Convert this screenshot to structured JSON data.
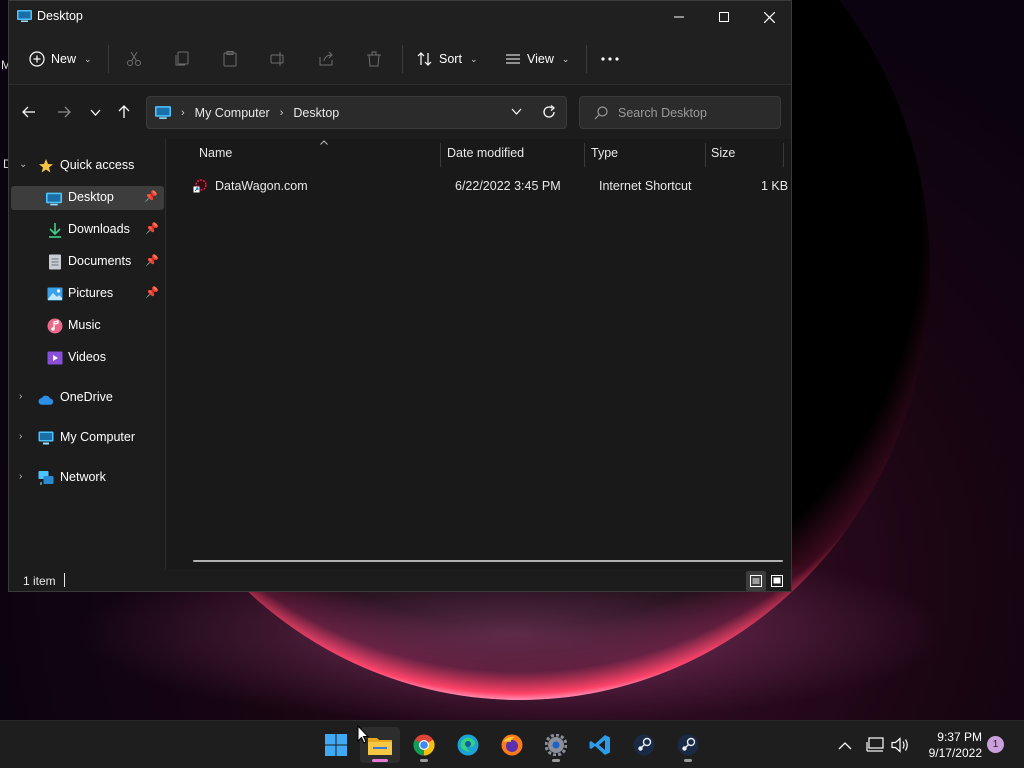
{
  "window": {
    "title": "Desktop"
  },
  "toolbar": {
    "new_label": "New",
    "sort_label": "Sort",
    "view_label": "View"
  },
  "address": {
    "crumbs": [
      "My Computer",
      "Desktop"
    ]
  },
  "search": {
    "placeholder": "Search Desktop"
  },
  "navpane": {
    "quick_access": "Quick access",
    "items": [
      {
        "label": "Desktop",
        "pinned": true,
        "selected": true,
        "icon": "desktop-icon"
      },
      {
        "label": "Downloads",
        "pinned": true,
        "icon": "download-icon"
      },
      {
        "label": "Documents",
        "pinned": true,
        "icon": "document-icon"
      },
      {
        "label": "Pictures",
        "pinned": true,
        "icon": "picture-icon"
      },
      {
        "label": "Music",
        "pinned": false,
        "icon": "music-icon"
      },
      {
        "label": "Videos",
        "pinned": false,
        "icon": "video-icon"
      }
    ],
    "onedrive": "OneDrive",
    "my_computer": "My Computer",
    "network": "Network"
  },
  "columns": {
    "name": "Name",
    "date": "Date modified",
    "type": "Type",
    "size": "Size"
  },
  "files": [
    {
      "name": "DataWagon.com",
      "date": "6/22/2022 3:45 PM",
      "type": "Internet Shortcut",
      "size": "1 KB"
    }
  ],
  "status": {
    "count": "1 item"
  },
  "desktop_fragments": {
    "a": "M",
    "b": "D"
  },
  "taskbar": {
    "apps": [
      "windows-start-icon",
      "file-explorer-icon",
      "chrome-icon",
      "edge-icon",
      "firefox-icon",
      "settings-icon",
      "vscode-icon",
      "steam-icon",
      "steam-icon"
    ],
    "time": "9:37 PM",
    "date": "9/17/2022",
    "notifications": "1"
  },
  "colors": {
    "accent": "#4cc2ff",
    "folder": "#f4c542",
    "taskbar": "#1e1e1e"
  }
}
